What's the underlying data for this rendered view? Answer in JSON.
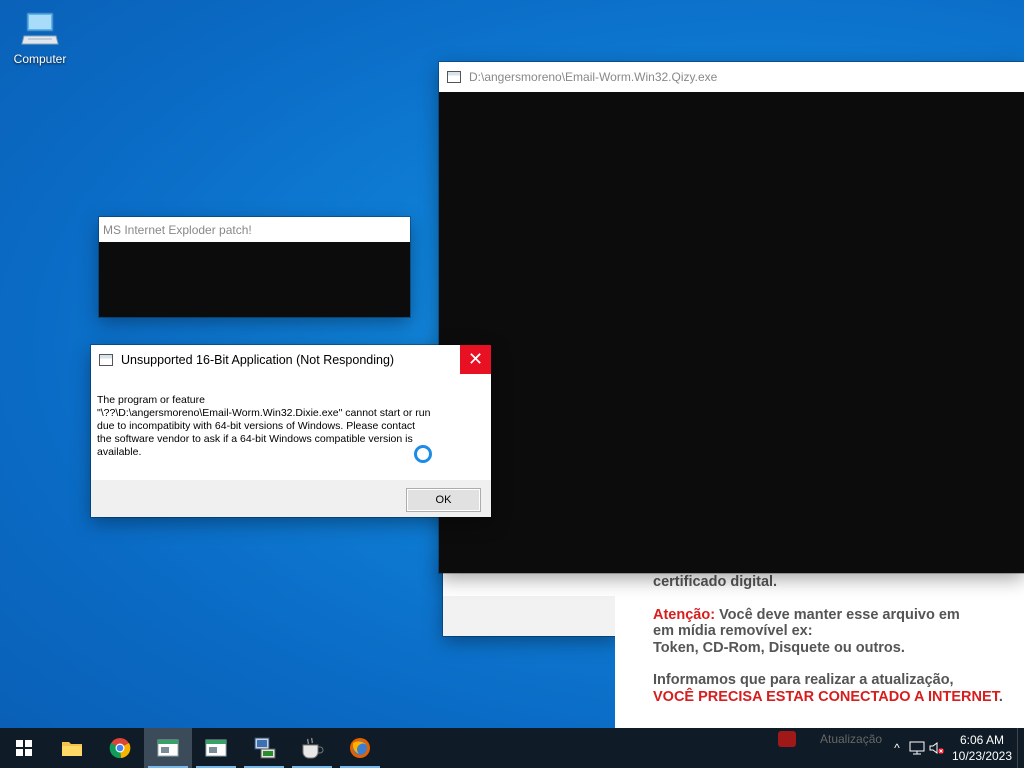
{
  "desktop": {
    "computer_label": "Computer"
  },
  "console_window": {
    "title": "D:\\angersmoreno\\Email-Worm.Win32.Qizy.exe"
  },
  "patch_window": {
    "title": "MS Internet Exploder patch!"
  },
  "ransom_page": {
    "line1": "certificado digital.",
    "attention_label": "Atenção:",
    "line2_rest": " Você deve manter esse arquivo em",
    "line3": "em mídia removível ex:",
    "line4": "Token, CD-Rom, Disquete ou outros.",
    "line5": "Informamos que para realizar a atualização,",
    "line6": "VOCÊ PRECISA ESTAR CONECTADO A INTERNET",
    "line6_end": ".",
    "behind_task": "Atualização"
  },
  "dialog": {
    "title": "Unsupported 16-Bit Application (Not Responding)",
    "close_glyph": "✕",
    "message": "The program or feature\n\"\\??\\D:\\angersmoreno\\Email-Worm.Win32.Dixie.exe\" cannot start or run\ndue to incompatibity with 64-bit versions of Windows. Please contact\nthe software vendor to ask if a 64-bit Windows compatible version is\navailable.",
    "ok_label": "OK"
  },
  "taskbar": {
    "items": [
      "start",
      "file-explorer",
      "chrome",
      "console-app",
      "console-app-2",
      "network-setup",
      "java",
      "firefox"
    ],
    "clock_time": "6:06 AM",
    "clock_date": "10/23/2023",
    "tray_chevron": "^"
  },
  "colors": {
    "accent": "#e81123",
    "taskbar": "#0f1b26",
    "alert_red": "#d71d1d"
  }
}
